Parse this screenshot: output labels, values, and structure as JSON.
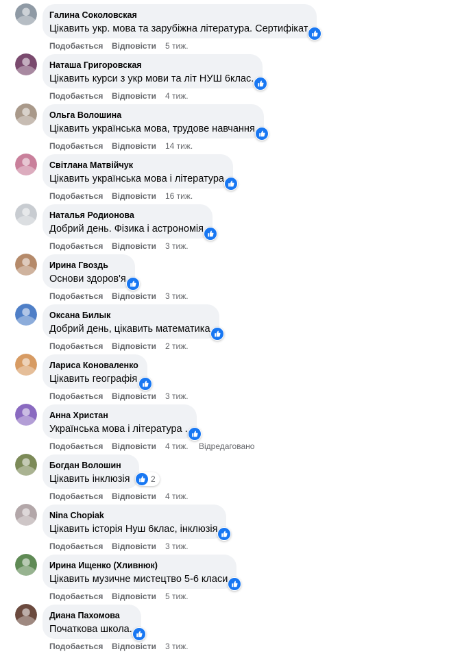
{
  "labels": {
    "like": "Подобається",
    "reply": "Відповісти",
    "edited": "Відредаговано"
  },
  "colors": {
    "bubble": "#f0f2f5",
    "meta_text": "#65676b",
    "like_blue": "#1877f2"
  },
  "comments": [
    {
      "author": "Галина Соколовская",
      "text": "Цікавить укр. мова та зарубіжна література. Сертифікат",
      "time": "5 тиж.",
      "reactions": "",
      "edited": "",
      "avatar_color": "#8f9aa5"
    },
    {
      "author": "Наташа Григоровская",
      "text": "Цікавить курси з укр мови та літ НУШ 6клас.",
      "time": "4 тиж.",
      "reactions": "",
      "edited": "",
      "avatar_color": "#7a4a6e"
    },
    {
      "author": "Ольга Волошина",
      "text": "Цікавить українська мова, трудове навчання",
      "time": "14 тиж.",
      "reactions": "",
      "edited": "",
      "avatar_color": "#a9998a"
    },
    {
      "author": "Світлана Матвійчук",
      "text": "Цікавить українська мова і література",
      "time": "16 тиж.",
      "reactions": "",
      "edited": "",
      "avatar_color": "#c9809b"
    },
    {
      "author": "Наталья Родионова",
      "text": "Добрий день. Фізика і астрономія",
      "time": "3 тиж.",
      "reactions": "",
      "edited": "",
      "avatar_color": "#c8ccd1"
    },
    {
      "author": "Ирина Гвоздь",
      "text": "Основи здоров'я",
      "time": "3 тиж.",
      "reactions": "",
      "edited": "",
      "avatar_color": "#b58a6a"
    },
    {
      "author": "Оксана Билык",
      "text": "Добрий день, цікавить математика",
      "time": "2 тиж.",
      "reactions": "",
      "edited": "",
      "avatar_color": "#4f7fc7"
    },
    {
      "author": "Лариса Коноваленко",
      "text": "Цікавить географія",
      "time": "3 тиж.",
      "reactions": "",
      "edited": "",
      "avatar_color": "#d79b63"
    },
    {
      "author": "Анна Христан",
      "text": "Українська мова і література .",
      "time": "4 тиж.",
      "reactions": "",
      "edited": "Відредаговано",
      "avatar_color": "#8a6ac0"
    },
    {
      "author": "Богдан Волошин",
      "text": "Цікавить інклюзія",
      "time": "4 тиж.",
      "reactions": "2",
      "edited": "",
      "avatar_color": "#7c8a58"
    },
    {
      "author": "Nina Chopiak",
      "text": "Цікавить історія Нуш 6клас, інклюзія",
      "time": "3 тиж.",
      "reactions": "",
      "edited": "",
      "avatar_color": "#b3a7a9"
    },
    {
      "author": "Ирина Ищенко (Хливнюк)",
      "text": "Цікавить музичне мистецтво 5-6 класи",
      "time": "5 тиж.",
      "reactions": "",
      "edited": "",
      "avatar_color": "#5f8a55"
    },
    {
      "author": "Диана Пахомова",
      "text": "Початкова школа.",
      "time": "3 тиж.",
      "reactions": "",
      "edited": "",
      "avatar_color": "#6b4a3e"
    }
  ]
}
